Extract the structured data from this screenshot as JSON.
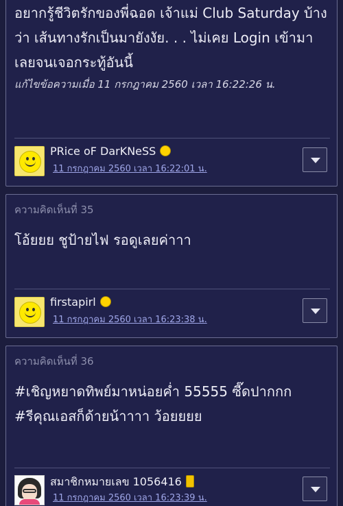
{
  "comments": [
    {
      "text": "อยากรู้ชีวิตรักของพี่ฉอด เจ้าแม่ Club Saturday บ้างว่า เส้นทางรักเป็นมายังงัย. . . ไม่เคย Login เข้ามาเลยจนเจอกระทู้อันนี้",
      "edit_note": "แก้ไขข้อความเมื่อ 11 กรกฎาคม 2560 เวลา 16:22:26 น.",
      "author": "PRice oF DarKNeSS",
      "date": "11 กรกฎาคม 2560 เวลา 16:22:01 น."
    },
    {
      "label": "ความคิดเห็นที่ 35",
      "text": "โอ้ยยย ชูป้ายไฟ รอดูเลยค่าาา",
      "author": "firstapirl",
      "date": "11 กรกฎาคม 2560 เวลา 16:23:38 น."
    },
    {
      "label": "ความคิดเห็นที่ 36",
      "text_line1": "#เชิญหยาดทิพย์มาหน่อยค่ำ 55555 ซี๊ดปากกก",
      "text_line2": "#รีคุณเอสก็ด้ายน้าาาา ว้อยยยย",
      "author": "สมาชิกหมายเลข 1056416",
      "date": "11 กรกฎาคม 2560 เวลา 16:23:39 น."
    }
  ],
  "icons": {
    "avatar_smiley": "smiley-avatar-icon",
    "avatar_photo": "user-photo-avatar",
    "badge_smiley": "smiley-badge-icon",
    "badge_phone": "mobile-phone-badge-icon",
    "menu": "chevron-down-icon"
  },
  "colors": {
    "background": "#1c1d3d",
    "card": "#20214a",
    "link": "#9fa6e8"
  }
}
